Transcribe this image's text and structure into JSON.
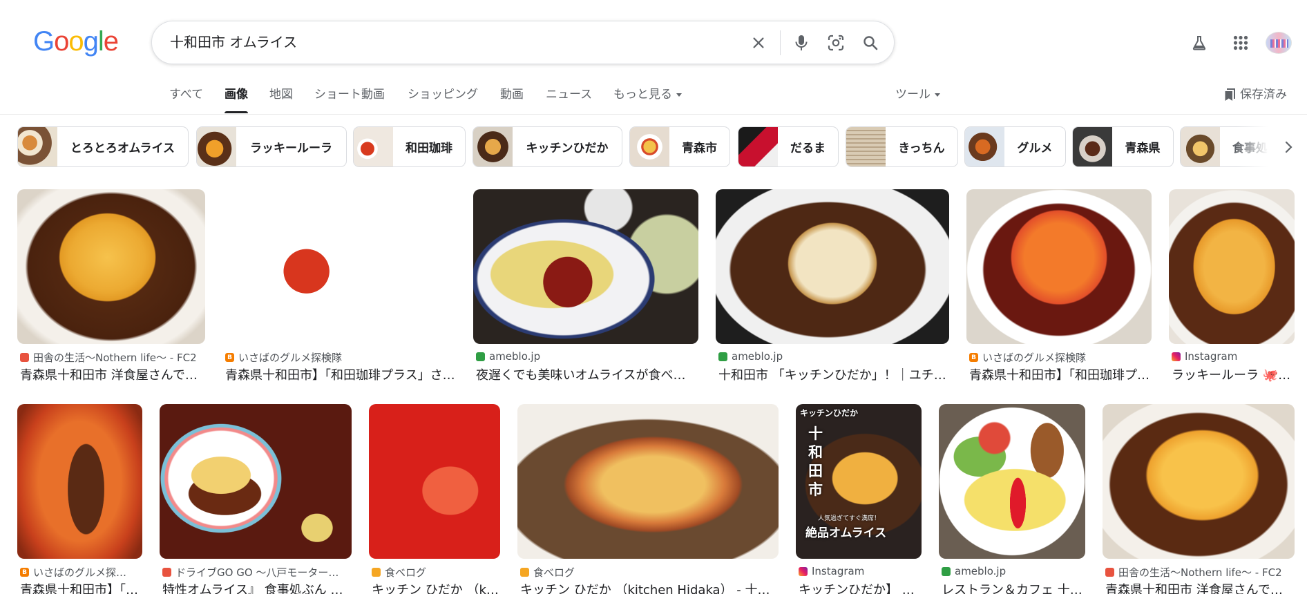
{
  "search": {
    "query": "十和田市 オムライス"
  },
  "tabs": [
    {
      "label": "すべて"
    },
    {
      "label": "画像"
    },
    {
      "label": "地図"
    },
    {
      "label": "ショート動画"
    },
    {
      "label": "ショッピング"
    },
    {
      "label": "動画"
    },
    {
      "label": "ニュース"
    },
    {
      "label": "もっと見る"
    }
  ],
  "tools_label": "ツール",
  "saved_label": "保存済み",
  "chips": [
    {
      "label": "とろとろオムライス"
    },
    {
      "label": "ラッキールーラ"
    },
    {
      "label": "和田珈琲"
    },
    {
      "label": "キッチンひだか"
    },
    {
      "label": "青森市"
    },
    {
      "label": "だるま"
    },
    {
      "label": "きっちん"
    },
    {
      "label": "グルメ"
    },
    {
      "label": "青森県"
    },
    {
      "label": "食事処"
    }
  ],
  "results": [
    {
      "source": "田舎の生活〜Nothern life〜 - FC2",
      "title": "青森県十和田市 洋食屋さんで…",
      "favicon": "fc2-icon"
    },
    {
      "source": "いさばのグルメ探検隊",
      "title": "青森県十和田市】「和田珈琲プラス」さ…",
      "favicon": "blogger-icon"
    },
    {
      "source": "ameblo.jp",
      "title": "夜遅くでも美味いオムライスが食べ…",
      "favicon": "ameblo-icon"
    },
    {
      "source": "ameblo.jp",
      "title": "十和田市 「キッチンひだか」！｜ユチ…",
      "favicon": "ameblo-icon"
    },
    {
      "source": "いさばのグルメ探検隊",
      "title": "青森県十和田市】「和田珈琲プ…",
      "favicon": "blogger-icon"
    },
    {
      "source": "Instagram",
      "title": "ラッキールーラ 🐙…",
      "favicon": "instagram-icon"
    },
    {
      "source": "いさばのグルメ探…",
      "title": "青森県十和田市】「…",
      "favicon": "blogger-icon"
    },
    {
      "source": "ドライブGO GO 〜八戸モーター…",
      "title": "特性オムライス』 食事処ぶん …",
      "favicon": "fc2-icon"
    },
    {
      "source": "食べログ",
      "title": "キッチン ひだか （k…",
      "favicon": "tabelog-icon"
    },
    {
      "source": "食べログ",
      "title": "キッチン ひだか （kitchen Hidaka） - 十和…",
      "favicon": "tabelog-icon"
    },
    {
      "source": "Instagram",
      "title": "キッチンひだか】 …",
      "favicon": "instagram-icon"
    },
    {
      "source": "ameblo.jp",
      "title": "レストラン＆カフェ 十…",
      "favicon": "ameblo-icon"
    },
    {
      "source": "田舎の生活〜Nothern life〜 - FC2",
      "title": "青森県十和田市 洋食屋さんで…",
      "favicon": "fc2-icon"
    }
  ],
  "image_overlay": {
    "top": "キッチンひだか",
    "vertical": "十和田市",
    "small": "人気過ぎてすぐ満席！",
    "big": "絶品オムライス"
  },
  "colors": {
    "accent": "#1a73e8",
    "text": "#202124",
    "muted": "#5f6368",
    "border": "#dadce0"
  }
}
